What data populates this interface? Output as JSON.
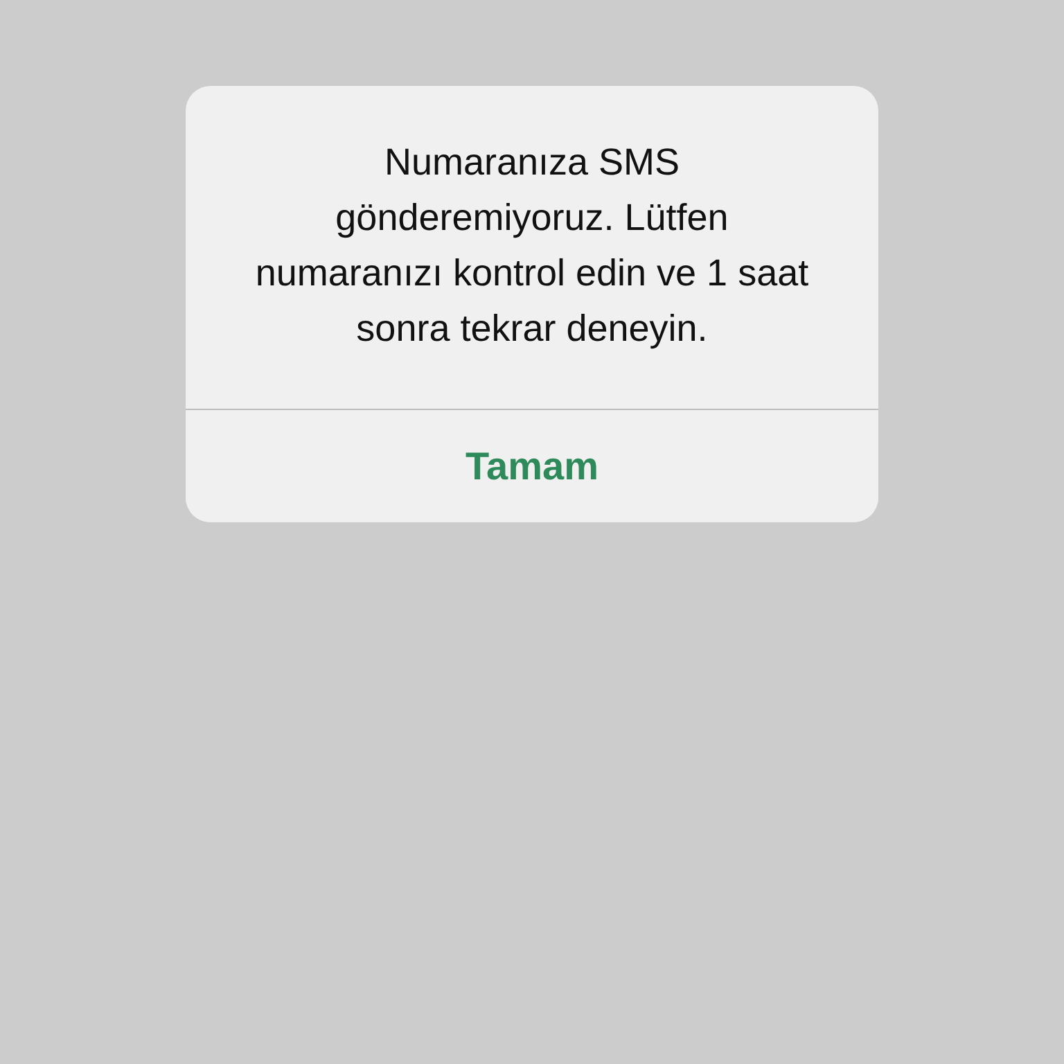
{
  "alert": {
    "message": "Numaranıza SMS gönderemiyoruz. Lütfen numaranızı kontrol edin ve 1 saat sonra tekrar deneyin.",
    "buttons": [
      "Tamam"
    ]
  }
}
